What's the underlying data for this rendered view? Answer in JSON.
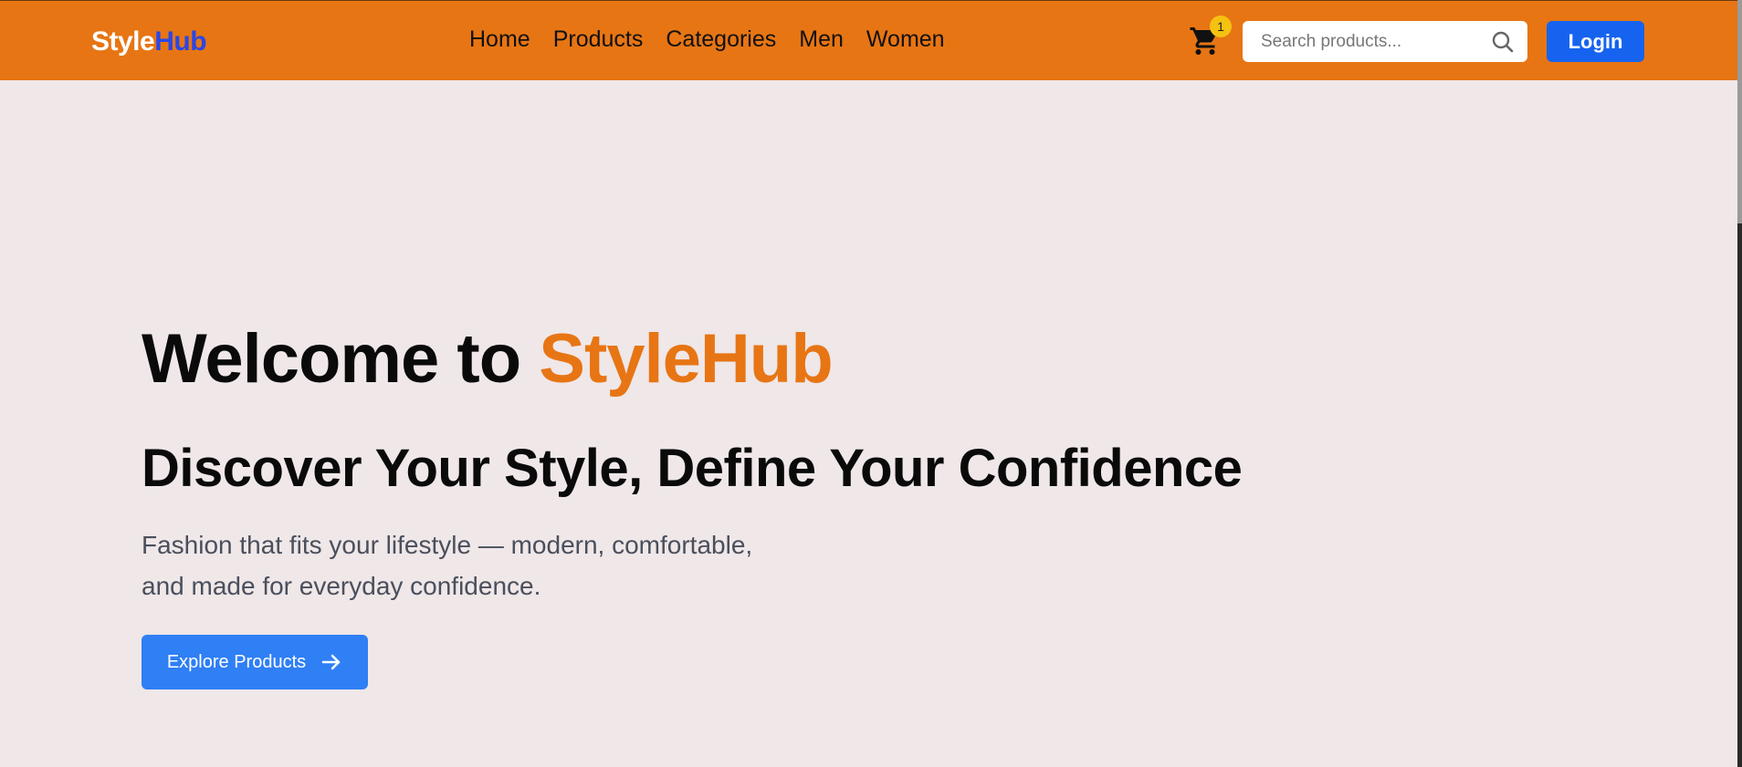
{
  "navbar": {
    "brand": {
      "part1": "Style",
      "part2": "Hub"
    },
    "links": [
      "Home",
      "Products",
      "Categories",
      "Men",
      "Women"
    ],
    "cart": {
      "icon": "cart-icon",
      "count": "1"
    },
    "search": {
      "placeholder": "Search products...",
      "value": "",
      "icon": "search-icon"
    },
    "login_label": "Login"
  },
  "hero": {
    "title_prefix": "Welcome to ",
    "title_accent": "StyleHub",
    "subtitle": "Discover Your Style, Define Your Confidence",
    "description_line1": "Fashion that fits your lifestyle — modern, comfortable,",
    "description_line2": "and made for everyday confidence.",
    "cta_label": "Explore Products",
    "cta_icon": "arrow-right-icon"
  },
  "colors": {
    "navbar_bg": "#e77514",
    "brand_accent": "#2a47e6",
    "page_bg": "#efe7e8",
    "primary_button": "#1663f0",
    "cta_button": "#2f7ff5",
    "badge": "#f5c211"
  }
}
